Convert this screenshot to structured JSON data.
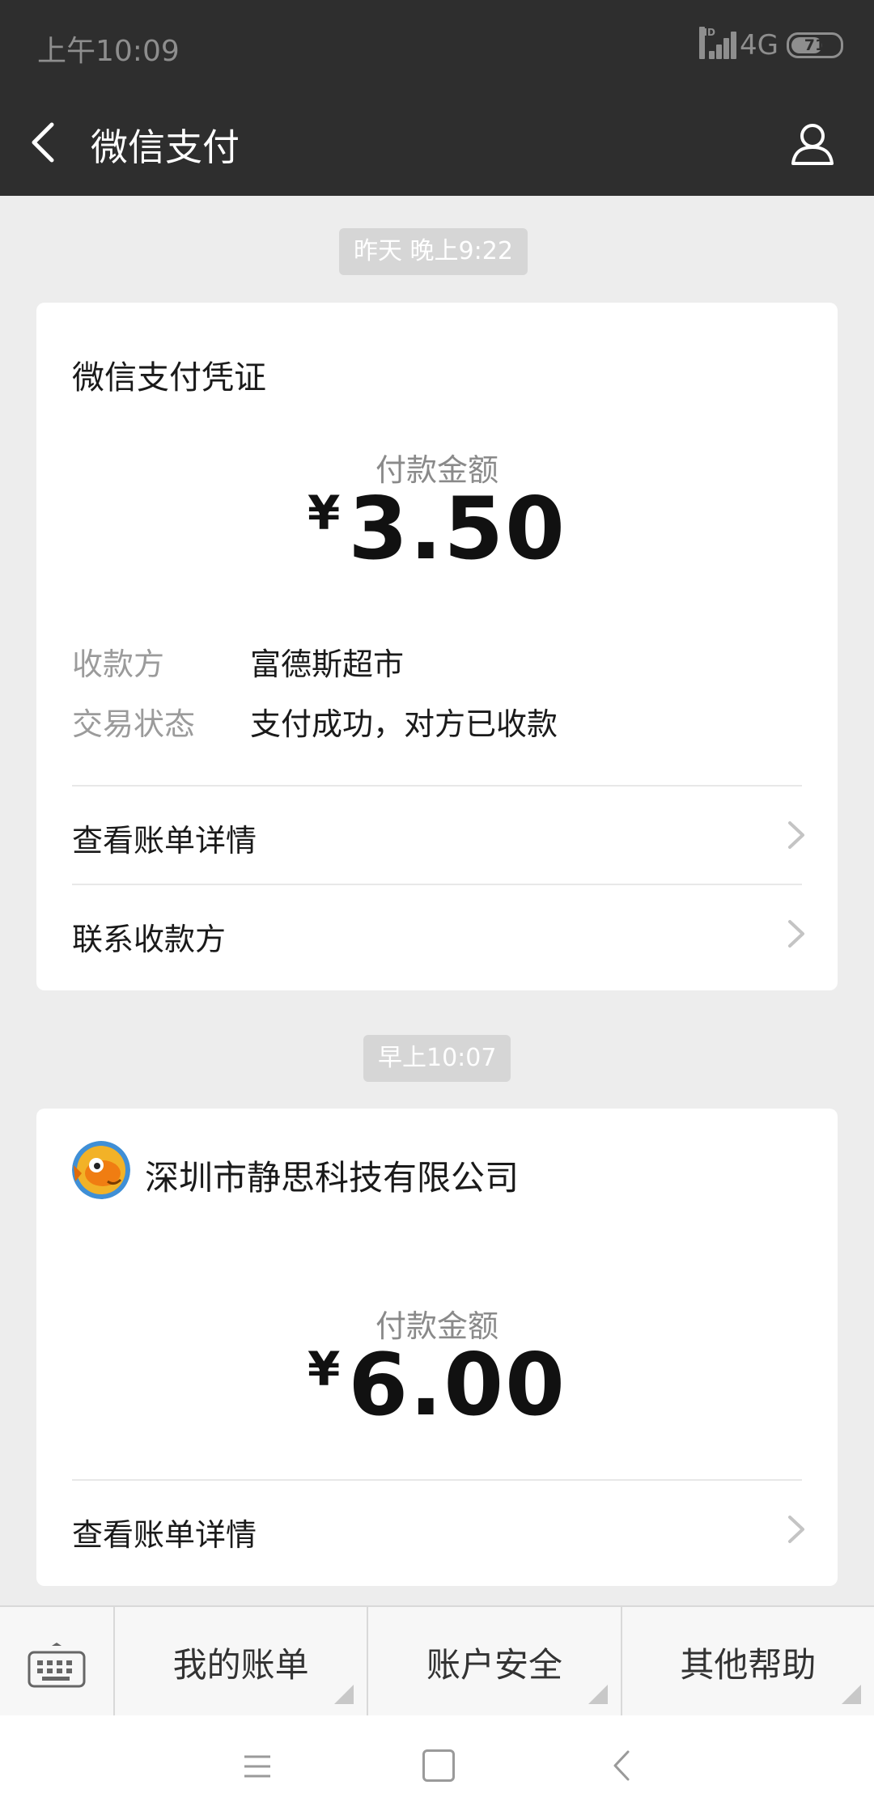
{
  "status": {
    "time": "上午10:09",
    "net": "4G",
    "hd": "HD",
    "battery": "71"
  },
  "header": {
    "title": "微信支付"
  },
  "chips": {
    "first": "昨天 晚上9:22",
    "second": "早上10:07"
  },
  "card1": {
    "title": "微信支付凭证",
    "amount_label": "付款金额",
    "currency": "¥",
    "amount": "3.50",
    "payee_key": "收款方",
    "payee_value": "富德斯超市",
    "status_key": "交易状态",
    "status_value": "支付成功，对方已收款",
    "link_bill": "查看账单详情",
    "link_contact": "联系收款方"
  },
  "card2": {
    "merchant": "深圳市静思科技有限公司",
    "amount_label": "付款金额",
    "currency": "¥",
    "amount": "6.00",
    "link_bill": "查看账单详情"
  },
  "menu": {
    "item1": "我的账单",
    "item2": "账户安全",
    "item3": "其他帮助"
  }
}
